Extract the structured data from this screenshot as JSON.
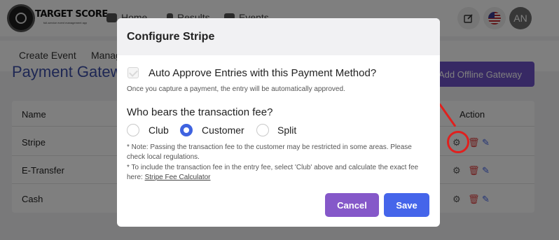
{
  "app": {
    "brand": "TARGET SCORE",
    "brand_sub": "full-service event management app",
    "nav": [
      "Home",
      "Results",
      "Events"
    ],
    "avatar_initials": "AN"
  },
  "subnav": [
    "Create Event",
    "Manag"
  ],
  "page": {
    "title": "Payment Gatew",
    "add_button": "Add Offline Gateway"
  },
  "table": {
    "headers": {
      "name": "Name",
      "action": "Action"
    },
    "rows": [
      "Stripe",
      "E-Transfer",
      "Cash"
    ]
  },
  "modal": {
    "title": "Configure Stripe",
    "auto_approve_label": "Auto Approve Entries with this Payment Method?",
    "auto_approve_hint": "Once you capture a payment, the entry will be automatically approved.",
    "fee_question": "Who bears the transaction fee?",
    "fee_options": [
      "Club",
      "Customer",
      "Split"
    ],
    "fee_selected": "Customer",
    "note_1": "* Note: Passing the transaction fee to the customer may be restricted in some areas. Please check local regulations.",
    "note_2_prefix": "* To include the transaction fee in the entry fee, select 'Club' above and calculate the exact fee here: ",
    "note_2_link": "Stripe Fee Calculator",
    "cancel_label": "Cancel",
    "save_label": "Save"
  },
  "colors": {
    "primary": "#4565ea",
    "cancel": "#8558c9",
    "annotation": "#e0201e",
    "title_blue": "#3d4fa8"
  }
}
